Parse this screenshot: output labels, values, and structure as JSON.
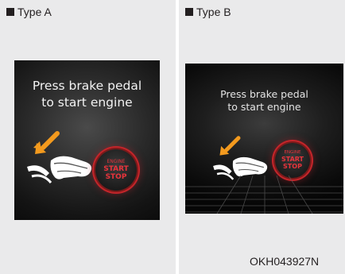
{
  "panels": [
    {
      "label": "Type A",
      "message": "Press brake pedal\nto start engine",
      "button": {
        "line1": "ENGINE",
        "line2": "START",
        "line3": "STOP"
      }
    },
    {
      "label": "Type B",
      "message": "Press brake pedal\nto start engine",
      "button": {
        "line1": "ENGINE",
        "line2": "START",
        "line3": "STOP"
      }
    }
  ],
  "figure_code": "OKH043927N",
  "colors": {
    "panel_bg": "#eaeaeb",
    "screen_bg": "#141414",
    "arrow": "#f39a1e",
    "button_ring": "#c3252a",
    "button_text": "#e8343c",
    "message_text": "#f2f2f2"
  },
  "icons": [
    "bullet-square-icon",
    "brake-pedal-icon",
    "foot-icon",
    "arrow-icon",
    "engine-start-stop-button-icon"
  ]
}
